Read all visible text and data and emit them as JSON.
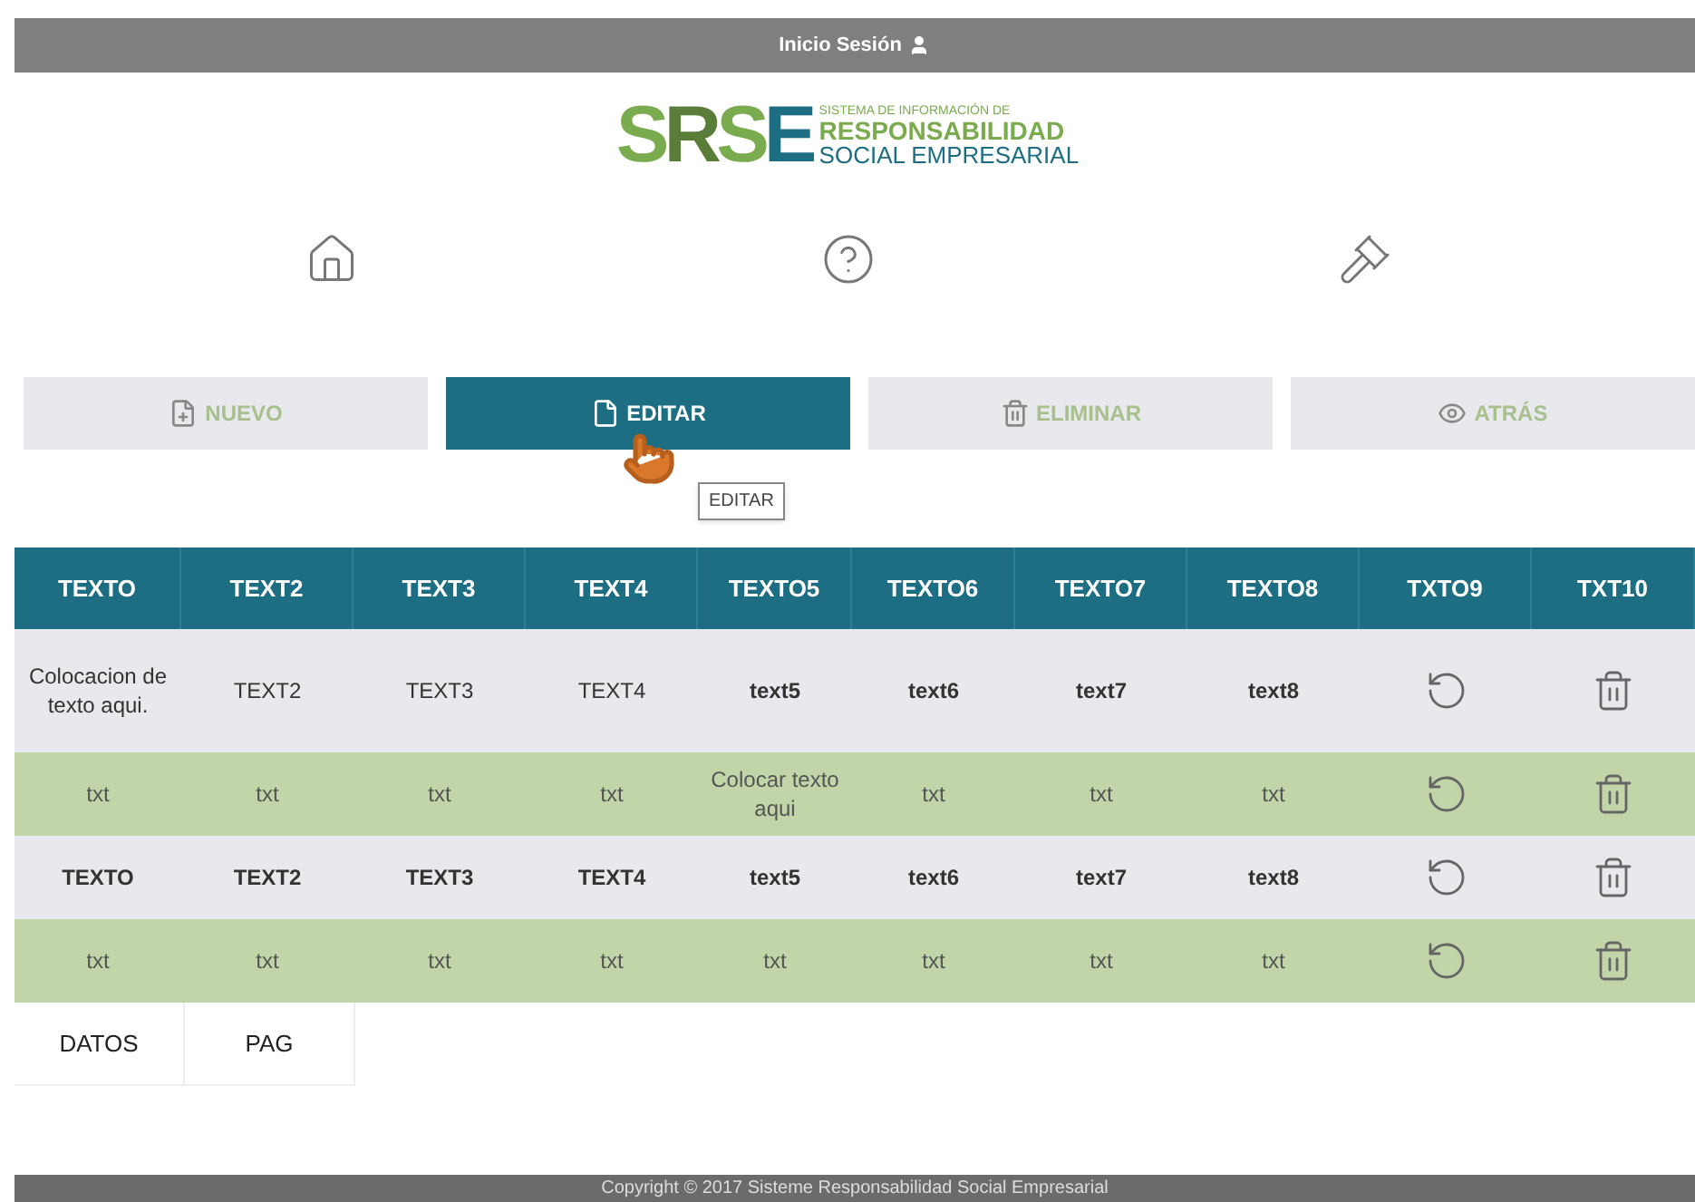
{
  "top_bar": {
    "login": "Inicio Sesión"
  },
  "logo": {
    "mark": "SRSE",
    "lines": [
      "SISTEMA DE INFORMACIÓN DE",
      "RESPONSABILIDAD",
      "SOCIAL EMPRESARIAL"
    ]
  },
  "nav_icons": [
    {
      "kind": "home"
    },
    {
      "kind": "help"
    },
    {
      "kind": "gavel"
    }
  ],
  "actions": [
    {
      "label": "NUEVO",
      "kind": "new",
      "selected": false
    },
    {
      "label": "EDITAR",
      "kind": "edit",
      "selected": true
    },
    {
      "label": "ELIMINAR",
      "kind": "delete",
      "selected": false
    },
    {
      "label": "ATRÁS",
      "kind": "back",
      "selected": false
    }
  ],
  "tooltip": "EDITAR",
  "table": {
    "columns": [
      "TEXTO",
      "TEXT2",
      "TEXT3",
      "TEXT4",
      "TEXTO5",
      "TEXTO6",
      "TEXTO7",
      "TEXTO8",
      "TXTO9",
      "TXT10"
    ],
    "rows": [
      {
        "kind": "light",
        "cells": [
          "Colocacion de texto aqui.",
          "TEXT2",
          "TEXT3",
          "TEXT4",
          "text5",
          "text6",
          "text7",
          "text8"
        ]
      },
      {
        "kind": "green",
        "cells": [
          "txt",
          "txt",
          "txt",
          "txt",
          "Colocar texto aqui",
          "txt",
          "txt",
          "txt"
        ]
      },
      {
        "kind": "light",
        "cells": [
          "TEXTO",
          "TEXT2",
          "TEXT3",
          "TEXT4",
          "text5",
          "text6",
          "text7",
          "text8"
        ]
      },
      {
        "kind": "green",
        "cells": [
          "txt",
          "txt",
          "txt",
          "txt",
          "txt",
          "txt",
          "txt",
          "txt"
        ]
      }
    ],
    "footer_cells": [
      "DATOS",
      "PAG"
    ]
  },
  "footer": "Copyright © 2017 Sisteme Responsabilidad Social Empresarial"
}
